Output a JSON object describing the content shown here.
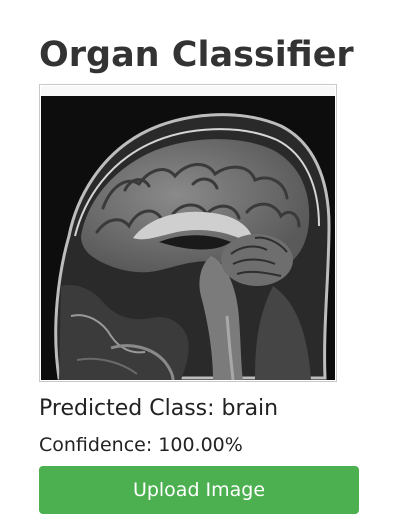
{
  "header": {
    "title": "Organ Classifier"
  },
  "preview": {
    "image_subject": "sagittal brain MRI scan"
  },
  "result": {
    "predicted_label": "Predicted Class: brain",
    "confidence_label": "Confidence: 100.00%"
  },
  "actions": {
    "upload_label": "Upload Image"
  },
  "colors": {
    "accent": "#4caf50",
    "title": "#333333",
    "text": "#222222",
    "frame_border": "#c9c9c9"
  }
}
